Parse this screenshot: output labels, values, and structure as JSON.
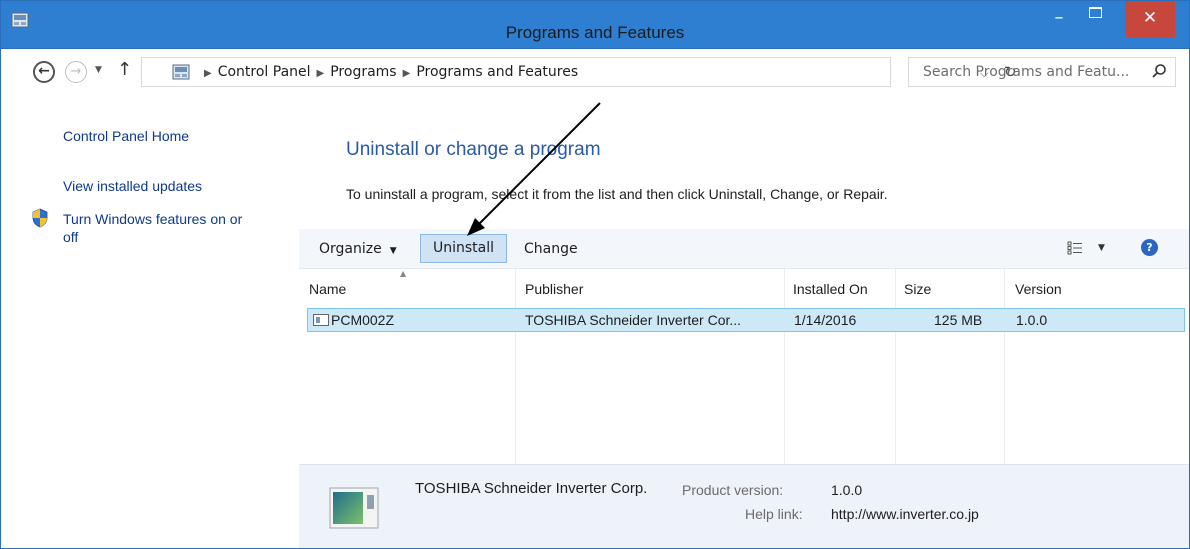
{
  "window": {
    "title": "Programs and Features",
    "minimize_glyph": "–",
    "close_glyph": "✕"
  },
  "nav": {
    "back_glyph": "←",
    "forward_glyph": "→",
    "dropdown_glyph": "▼",
    "up_glyph": "↑",
    "breadcrumb": [
      "Control Panel",
      "Programs",
      "Programs and Features"
    ],
    "crumb_sep": "▶",
    "refresh_glyph": "↻",
    "search_placeholder": "Search Programs and Featu..."
  },
  "sidebar": {
    "items": [
      {
        "label": "Control Panel Home"
      },
      {
        "label": "View installed updates"
      },
      {
        "label": "Turn Windows features on or"
      },
      {
        "label": "off"
      }
    ]
  },
  "main": {
    "heading": "Uninstall or change a program",
    "instructions": "To uninstall a program, select it from the list and then click Uninstall, Change, or Repair."
  },
  "toolbar": {
    "organize_label": "Organize",
    "organize_caret": "▼",
    "uninstall_label": "Uninstall",
    "change_label": "Change",
    "view_caret": "▼",
    "help_glyph": "?"
  },
  "list": {
    "sort_glyph": "▲",
    "columns": [
      "Name",
      "Publisher",
      "Installed On",
      "Size",
      "Version"
    ],
    "rows": [
      {
        "name": "PCM002Z",
        "publisher": "TOSHIBA Schneider Inverter Cor...",
        "installed_on": "1/14/2016",
        "size": "125 MB",
        "version": "1.0.0"
      }
    ]
  },
  "details": {
    "publisher": "TOSHIBA Schneider Inverter Corp.",
    "product_version_label": "Product version:",
    "product_version": "1.0.0",
    "help_link_label": "Help link:",
    "help_link": "http://www.inverter.co.jp"
  },
  "colors": {
    "titlebar": "#2e7fd1",
    "close_button": "#c7473c",
    "link": "#0f3a8a",
    "heading": "#2a5aa6",
    "selection": "#cde8f7"
  }
}
